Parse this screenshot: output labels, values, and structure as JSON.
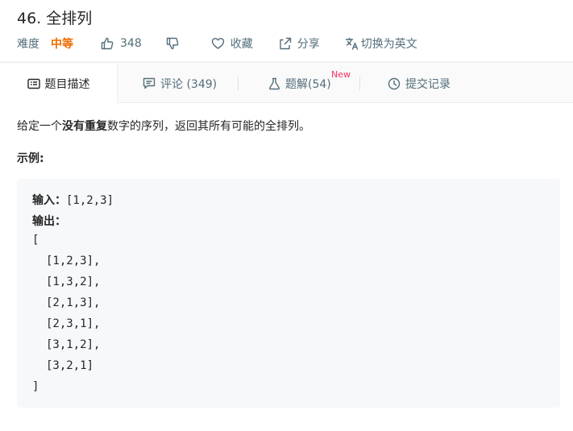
{
  "problem": {
    "title": "46. 全排列",
    "difficulty_label": "难度",
    "difficulty_value": "中等",
    "likes": "348",
    "favorite_label": "收藏",
    "share_label": "分享",
    "language_label": "切换为英文"
  },
  "tabs": [
    {
      "label": "题目描述",
      "icon": "description-icon",
      "active": true
    },
    {
      "label": "评论 (349)",
      "icon": "comment-icon",
      "active": false
    },
    {
      "label": "题解(54)",
      "icon": "flask-icon",
      "active": false,
      "badge": "New"
    },
    {
      "label": "提交记录",
      "icon": "clock-icon",
      "active": false
    }
  ],
  "description": {
    "prefix": "给定一个",
    "bold": "没有重复",
    "suffix": "数字的序列，返回其所有可能的全排列。"
  },
  "example": {
    "label": "示例:",
    "input_label": "输入：",
    "input_value": "[1,2,3]",
    "output_label": "输出：",
    "output_lines": [
      "[",
      "[1,2,3],",
      "[1,3,2],",
      "[2,1,3],",
      "[2,3,1],",
      "[3,1,2],",
      "[3,2,1]",
      "]"
    ]
  },
  "colors": {
    "difficulty_medium": "#ef6c00",
    "new_badge": "#ff2e63",
    "meta_text": "#546e7a",
    "code_bg": "#f7f8fa"
  }
}
